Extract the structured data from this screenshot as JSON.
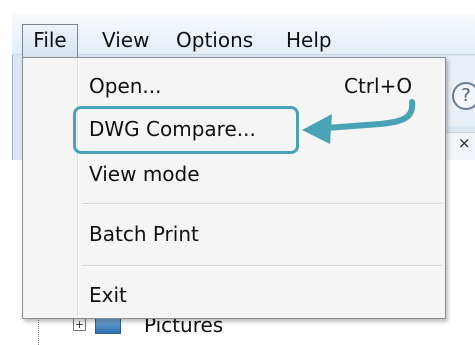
{
  "menubar": {
    "items": [
      {
        "label": "File"
      },
      {
        "label": "View"
      },
      {
        "label": "Options"
      },
      {
        "label": "Help"
      }
    ]
  },
  "file_menu": {
    "items": [
      {
        "label": "Open...",
        "shortcut": "Ctrl+O"
      },
      {
        "label": "DWG Compare..."
      },
      {
        "label": "View mode"
      },
      {
        "label": "Batch Print"
      },
      {
        "label": "Exit"
      }
    ]
  },
  "toolbar": {
    "help_icon": "?",
    "close_glyph": "×"
  },
  "tree": {
    "expander_glyph": "+",
    "item_label": "Pictures"
  },
  "annotation": {
    "highlight_color": "#4aa3b5",
    "target": "DWG Compare..."
  },
  "colors": {
    "menubar_bg": "#e4edf6",
    "menu_bg": "#f5f5f5",
    "accent": "#4aa3b5"
  }
}
